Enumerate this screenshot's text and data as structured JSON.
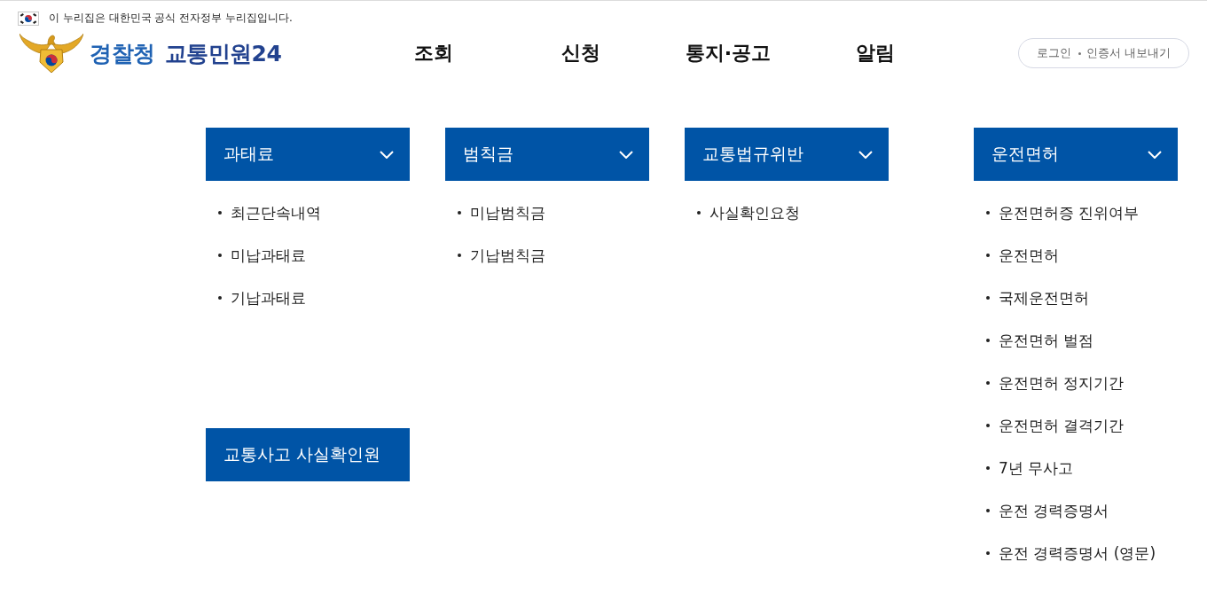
{
  "notice": {
    "text": "이 누리집은 대한민국 공식 전자정부 누리집입니다."
  },
  "logo": {
    "agency": "경찰청",
    "service": "교통민원24"
  },
  "nav": [
    {
      "label": "조회"
    },
    {
      "label": "신청"
    },
    {
      "label": "통지·공고"
    },
    {
      "label": "알림"
    }
  ],
  "account_links": [
    "로그인",
    "인증서 내보내기"
  ],
  "menu_columns": [
    {
      "sections": [
        {
          "kind": "dropdown",
          "title": "과태료",
          "items": [
            "최근단속내역",
            "미납과태료",
            "기납과태료"
          ]
        },
        {
          "kind": "link",
          "title": "교통사고 사실확인원"
        }
      ]
    },
    {
      "sections": [
        {
          "kind": "dropdown",
          "title": "범칙금",
          "items": [
            "미납범칙금",
            "기납범칙금"
          ]
        }
      ]
    },
    {
      "sections": [
        {
          "kind": "dropdown",
          "title": "교통법규위반",
          "items": [
            "사실확인요청"
          ]
        }
      ]
    },
    {
      "sections": [
        {
          "kind": "dropdown",
          "title": "운전면허",
          "items": [
            "운전면허증 진위여부",
            "운전면허",
            "국제운전면허",
            "운전면허 벌점",
            "운전면허 정지기간",
            "운전면허 결격기간",
            "7년 무사고",
            "운전 경력증명서",
            "운전 경력증명서 (영문)"
          ]
        }
      ]
    }
  ]
}
